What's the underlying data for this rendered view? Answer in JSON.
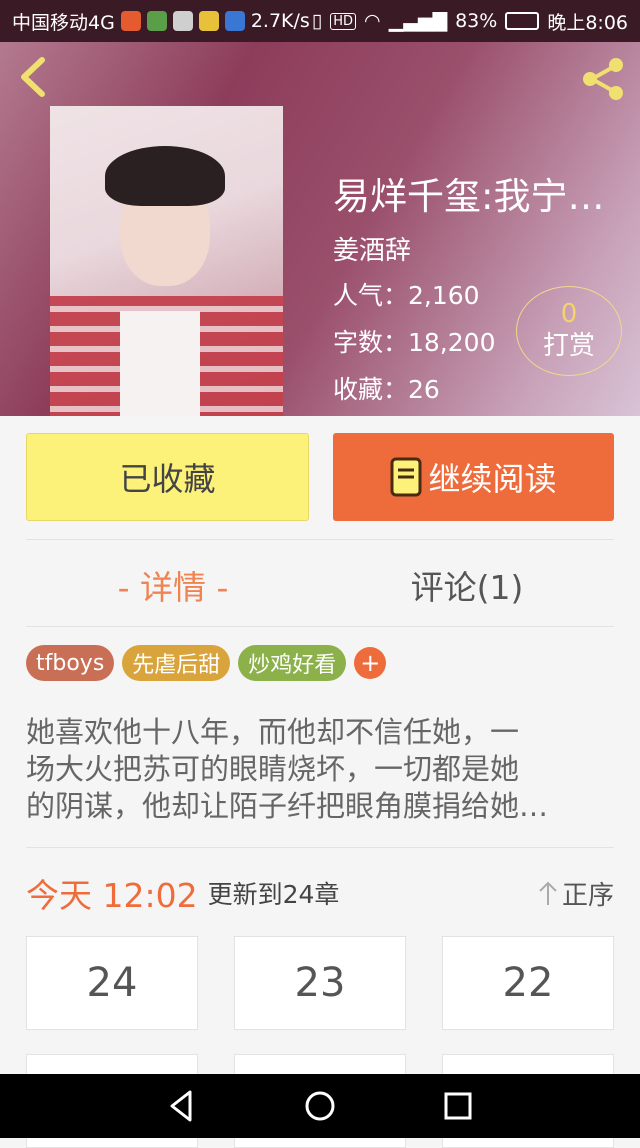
{
  "status_bar": {
    "carrier": "中国移动4G",
    "speed": "2.7K/s",
    "battery": "83%",
    "time": "晚上8:06"
  },
  "header": {
    "back_icon": "back-arrow-icon",
    "share_icon": "share-icon"
  },
  "book": {
    "title": "易烊千玺:我宁…",
    "author": "姜酒辞",
    "popularity": "人气：2,160",
    "word_count": "字数：18,200",
    "favorites": "收藏：26"
  },
  "reward": {
    "count": "0",
    "label": "打赏"
  },
  "actions": {
    "favorite_label": "已收藏",
    "continue_label": "继续阅读"
  },
  "tabs": {
    "detail": "- 详情 -",
    "comments": "评论(1)"
  },
  "tags": [
    "tfboys",
    "先虐后甜",
    "炒鸡好看"
  ],
  "tag_add": "+",
  "description": [
    "她喜欢他十八年，而他却不信任她，一",
    "场大火把苏可的眼睛烧坏，一切都是她",
    "的阴谋，他却让陌子纤把眼角膜捐给她…"
  ],
  "update": {
    "time": "今天 12:02",
    "chapter": "更新到24章",
    "sort_label": "正序"
  },
  "chapters": [
    "24",
    "23",
    "22"
  ],
  "colors": {
    "accent": "#ee6c3b",
    "favorite_button": "#fdf279",
    "tag_1": "#c96f55",
    "tag_2": "#d9a43c",
    "tag_3": "#8cb14b"
  }
}
